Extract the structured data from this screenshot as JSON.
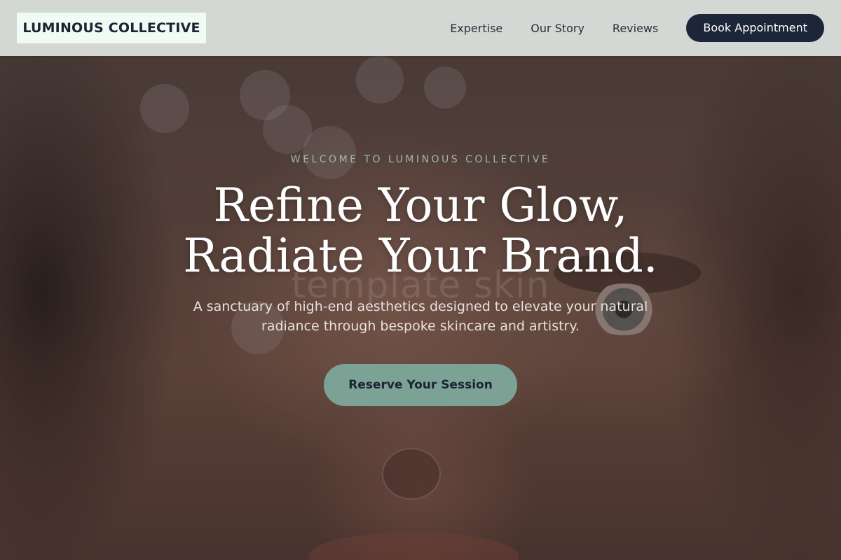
{
  "header": {
    "logo": "LUMINOUS COLLECTIVE",
    "nav": [
      {
        "label": "Expertise"
      },
      {
        "label": "Our Story"
      },
      {
        "label": "Reviews"
      }
    ],
    "book_label": "Book Appointment"
  },
  "hero": {
    "eyebrow": "WELCOME TO LUMINOUS COLLECTIVE",
    "headline_line1": "Refine Your Glow,",
    "headline_line2": "Radiate Your Brand.",
    "watermark": "template skin",
    "subtext": "A sanctuary of high-end aesthetics designed to elevate your natural radiance through bespoke skincare and artistry.",
    "cta_label": "Reserve Your Session"
  },
  "colors": {
    "header_bg": "#dee4e0",
    "logo_bg": "#f0fbf5",
    "primary_dark": "#1c2638",
    "accent_sage": "#7ba295",
    "eyebrow": "#9fb8ae",
    "headline": "#ffffff"
  }
}
